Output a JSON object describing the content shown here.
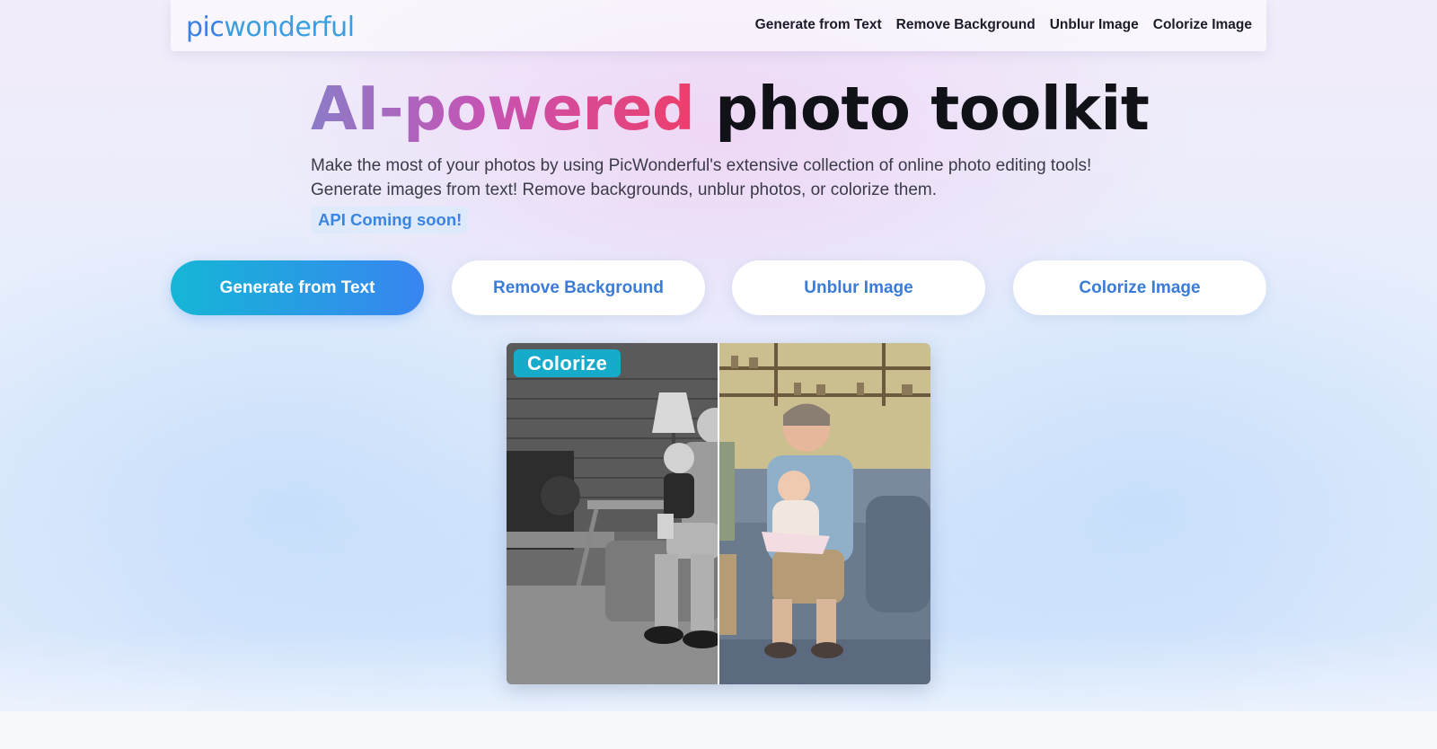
{
  "header": {
    "logo": {
      "part1": "pic",
      "part2": "wonderful"
    },
    "nav": [
      "Generate from Text",
      "Remove Background",
      "Unblur Image",
      "Colorize Image"
    ]
  },
  "hero": {
    "title_gradient": "AI-powered",
    "title_rest": "photo toolkit",
    "subtitle_line1": "Make the most of your photos by using PicWonderful's extensive collection of online photo editing tools!",
    "subtitle_line2": "Generate images from text! Remove backgrounds, unblur photos, or colorize them.",
    "api_badge": "API Coming soon!"
  },
  "tools": {
    "buttons": [
      "Generate from Text",
      "Remove Background",
      "Unblur Image",
      "Colorize Image"
    ],
    "active_index": 0
  },
  "preview": {
    "badge": "Colorize",
    "split_position": 0.5
  },
  "colors": {
    "logo_pic": "#3b82e6",
    "logo_rest": "#3a9fe0",
    "title_gradient_start": "#8b7cc8",
    "title_gradient_end": "#ee3e6b",
    "button_gradient_start": "#15b6d6",
    "button_gradient_end": "#3885f0",
    "inactive_button_text": "#3b7bd9",
    "badge_bg": "#16aacb"
  }
}
